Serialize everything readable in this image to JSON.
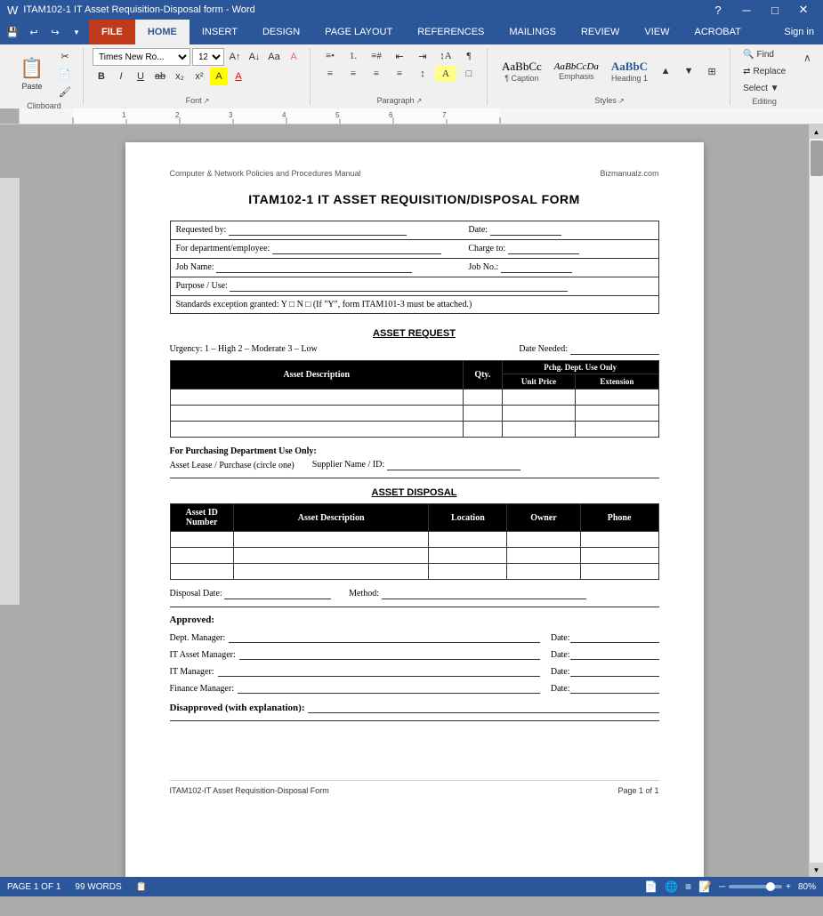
{
  "window": {
    "title": "ITAM102-1 IT Asset Requisition-Disposal form - Word",
    "app": "Word"
  },
  "quickaccess": {
    "buttons": [
      "💾",
      "↩",
      "↪",
      "▼"
    ]
  },
  "ribbon": {
    "tabs": [
      "FILE",
      "HOME",
      "INSERT",
      "DESIGN",
      "PAGE LAYOUT",
      "REFERENCES",
      "MAILINGS",
      "REVIEW",
      "VIEW",
      "ACROBAT"
    ],
    "active_tab": "HOME",
    "font": {
      "name": "Times New Ro...",
      "size": "12"
    },
    "styles": [
      {
        "label": "¶ Caption",
        "preview": "AaBbCc"
      },
      {
        "label": "Emphasis",
        "preview": "AaBbCcDa"
      },
      {
        "label": "Heading 1",
        "preview": "AaBbC"
      }
    ],
    "editing": {
      "find": "Find",
      "replace": "Replace",
      "select": "Select ▼"
    },
    "groups": {
      "clipboard": "Clipboard",
      "font": "Font",
      "paragraph": "Paragraph",
      "styles": "Styles",
      "editing": "Editing"
    }
  },
  "document": {
    "header_left": "Computer & Network Policies and Procedures Manual",
    "header_right": "Bizmanualz.com",
    "title": "ITAM102-1  IT ASSET REQUISITION/DISPOSAL FORM",
    "info_fields": {
      "requested_by": "Requested by:",
      "date": "Date:",
      "for_dept": "For department/employee:",
      "charge_to": "Charge to:",
      "job_name": "Job Name:",
      "job_no": "Job No.:",
      "purpose": "Purpose / Use:",
      "standards": "Standards exception granted: Y □  N □  (If \"Y\", form ITAM101-3 must be attached.)"
    },
    "asset_request": {
      "section_title": "ASSET REQUEST",
      "urgency_label": "Urgency:   1 – High    2 – Moderate    3 – Low",
      "date_needed_label": "Date Needed:",
      "table_headers": {
        "asset_description": "Asset Description",
        "qty": "Qty.",
        "unit_price": "Unit Price",
        "extension": "Extension",
        "dept_use_only": "Pchg. Dept. Use Only"
      },
      "purchase_dept": {
        "label": "For Purchasing Department Use Only:",
        "asset_lease": "Asset Lease / Purchase (circle one)",
        "supplier": "Supplier Name / ID:"
      }
    },
    "asset_disposal": {
      "section_title": "ASSET DISPOSAL",
      "table_headers": {
        "asset_id": "Asset ID Number",
        "asset_description": "Asset Description",
        "location": "Location",
        "owner": "Owner",
        "phone": "Phone"
      },
      "disposal_date_label": "Disposal Date:",
      "method_label": "Method:"
    },
    "approvals": {
      "approved_label": "Approved:",
      "dept_manager": "Dept. Manager:",
      "it_asset_manager": "IT Asset Manager:",
      "it_manager": "IT Manager:",
      "finance_manager": "Finance Manager:",
      "date_label": "Date:",
      "disapproved_label": "Disapproved (with explanation):"
    },
    "footer_left": "ITAM102-IT Asset Requisition-Disposal Form",
    "footer_right": "Page 1 of 1"
  },
  "statusbar": {
    "page": "PAGE 1 OF 1",
    "words": "99 WORDS",
    "zoom": "80%"
  }
}
